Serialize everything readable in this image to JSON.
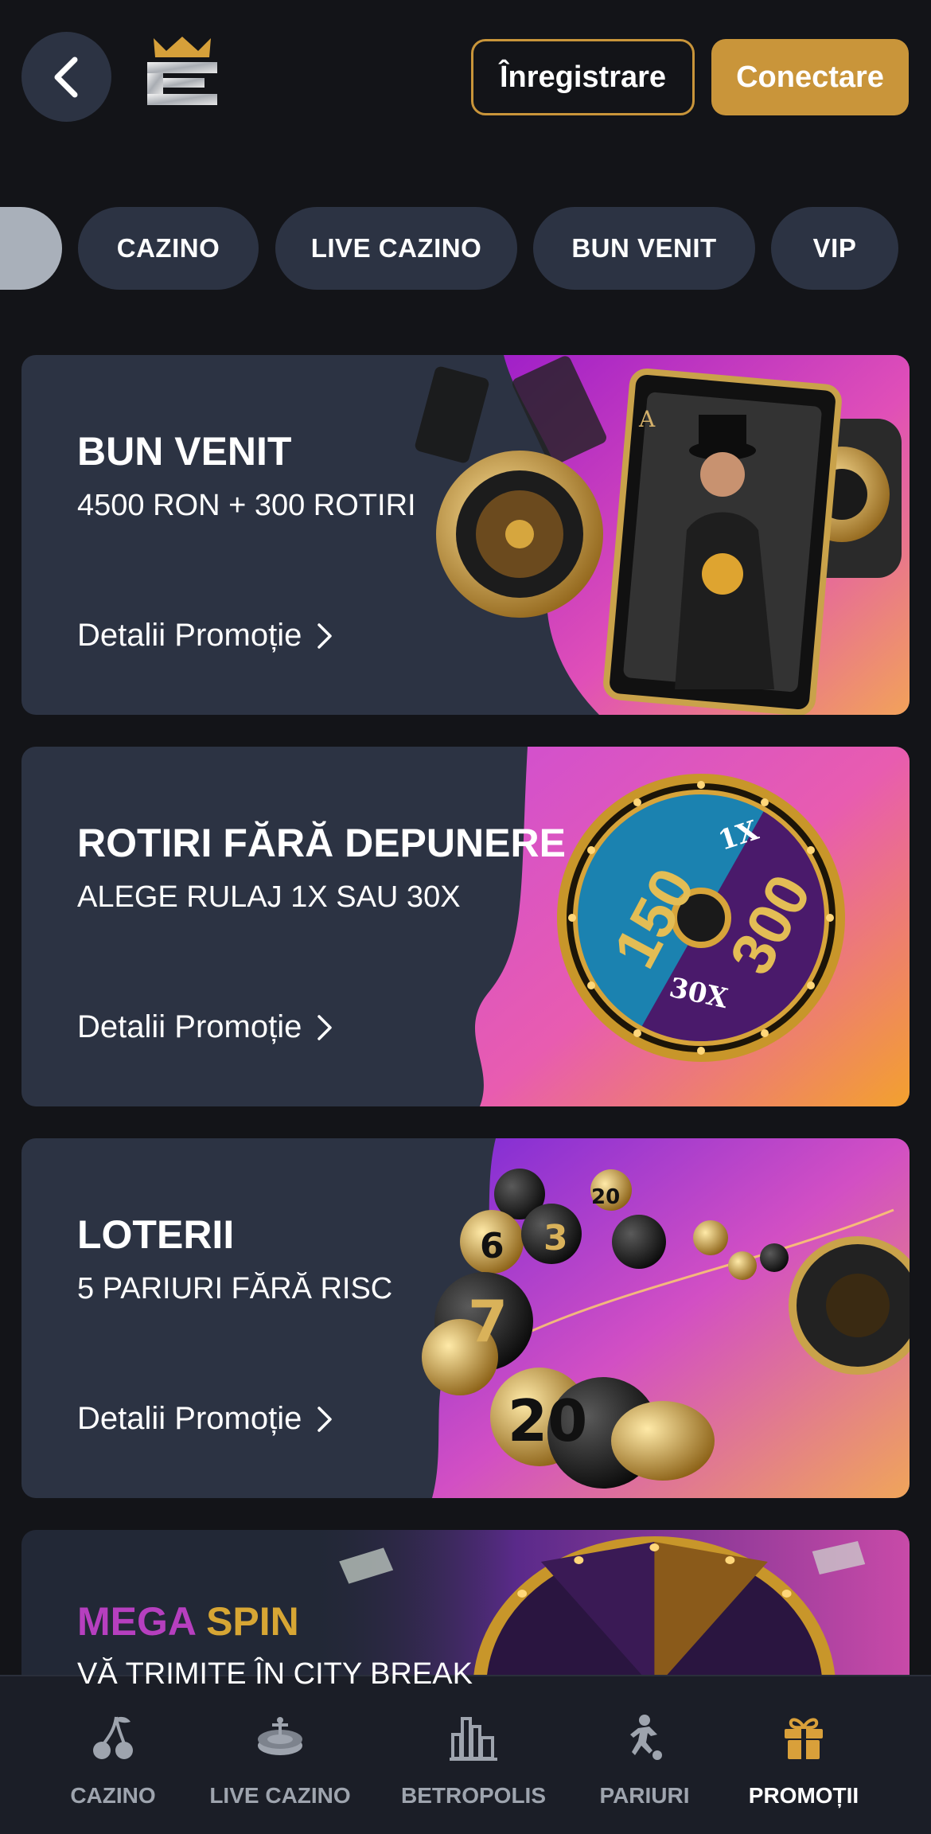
{
  "header": {
    "back_icon": "chevron-left-icon",
    "logo_icon": "crown-logo-icon",
    "register_label": "Înregistrare",
    "login_label": "Conectare"
  },
  "categories": [
    "CAZINO",
    "LIVE CAZINO",
    "BUN VENIT",
    "VIP"
  ],
  "promos": [
    {
      "title": "BUN VENIT",
      "subtitle": "4500 RON + 300 ROTIRI",
      "link": "Detalii Promoție"
    },
    {
      "title": "ROTIRI FĂRĂ DEPUNERE",
      "subtitle": "ALEGE RULAJ 1X SAU 30X",
      "link": "Detalii Promoție",
      "wheel": {
        "left": "150",
        "right": "300",
        "top": "1X",
        "bottom": "30X"
      }
    },
    {
      "title": "LOTERII",
      "subtitle": "5 PARIURI FĂRĂ RISC",
      "link": "Detalii Promoție"
    },
    {
      "title_part1": "MEGA",
      "title_part2": "SPIN",
      "subtitle": "VĂ TRIMITE ÎN CITY BREAK"
    }
  ],
  "bottom_nav": [
    {
      "label": "CAZINO",
      "icon": "cherries-icon",
      "active": false
    },
    {
      "label": "LIVE CAZINO",
      "icon": "roulette-icon",
      "active": false
    },
    {
      "label": "BETROPOLIS",
      "icon": "city-skyline-icon",
      "active": false
    },
    {
      "label": "PARIURI",
      "icon": "soccer-player-icon",
      "active": false
    },
    {
      "label": "PROMOȚII",
      "icon": "gift-icon",
      "active": true
    }
  ],
  "colors": {
    "background": "#131418",
    "card": "#2c3343",
    "accent_gold": "#c9953a",
    "mega_magenta": "#b63fbf"
  }
}
